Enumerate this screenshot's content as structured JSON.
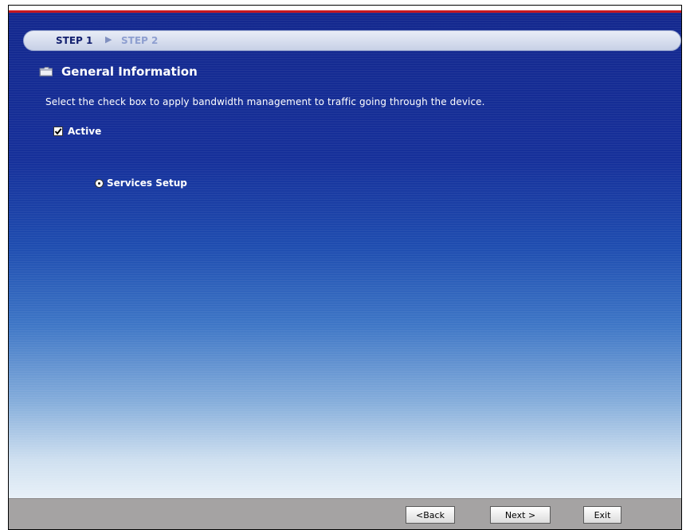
{
  "steps": {
    "step1": "STEP 1",
    "separator": "▶",
    "step2": "STEP 2"
  },
  "section": {
    "title": "General Information",
    "icon": "folder-icon"
  },
  "description": "Select the check box to apply bandwidth management to traffic going through the device.",
  "active": {
    "label": "Active",
    "checked": true
  },
  "services": {
    "label": "Services Setup",
    "selected": true
  },
  "buttons": {
    "back": "<Back",
    "next": "Next >",
    "exit": "Exit"
  },
  "colors": {
    "panel_top": "#14288e",
    "panel_bottom": "#e9f1f8",
    "accent_line": "#c7161f",
    "button_bar": "#a5a3a3"
  }
}
